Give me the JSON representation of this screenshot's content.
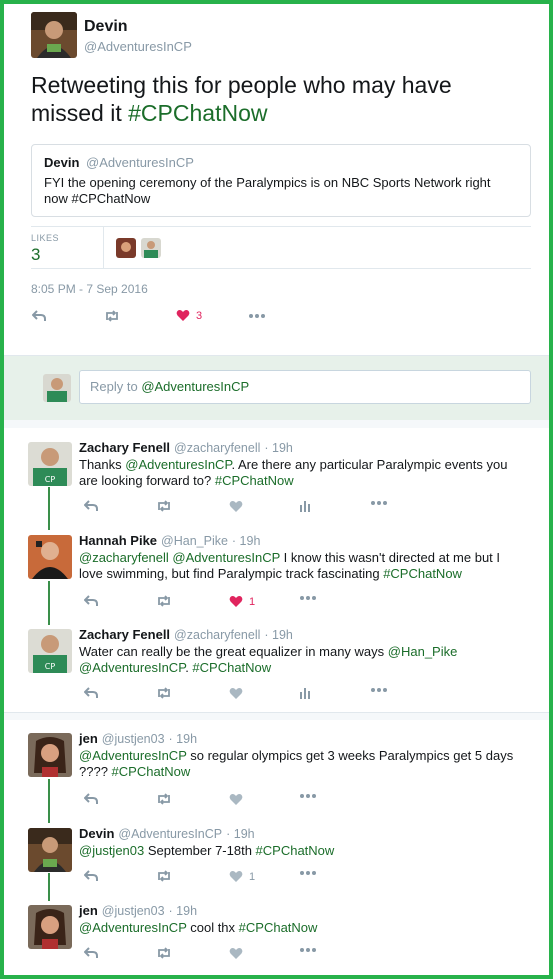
{
  "main": {
    "author_name": "Devin",
    "author_handle": "@AdventuresInCP",
    "text": "Retweeting this for people who may have missed it ",
    "hashtag": "#CPChatNow",
    "quoted": {
      "name": "Devin",
      "handle": "@AdventuresInCP",
      "text": "FYI the opening ceremony of the Paralympics is on NBC Sports Network right now #CPChatNow"
    },
    "likes_label": "LIKES",
    "likes_count": "3",
    "timestamp": "8:05 PM - 7 Sep 2016",
    "heart_count": "3"
  },
  "reply_box": {
    "placeholder_prefix": "Reply to ",
    "placeholder_handle": "@AdventuresInCP"
  },
  "thread1": [
    {
      "name": "Zachary Fenell",
      "handle": "@zacharyfenell",
      "time": "· 19h",
      "text_parts": [
        {
          "t": "Thanks ",
          "link": false
        },
        {
          "t": "@AdventuresInCP",
          "link": true
        },
        {
          "t": ". Are there any particular Paralympic events you are looking forward to? ",
          "link": false
        },
        {
          "t": "#CPChatNow",
          "link": true
        }
      ],
      "like_count": "",
      "liked": false,
      "analytics": true
    },
    {
      "name": "Hannah Pike",
      "handle": "@Han_Pike",
      "time": "· 19h",
      "text_parts": [
        {
          "t": "@zacharyfenell",
          "link": true
        },
        {
          "t": " ",
          "link": false
        },
        {
          "t": "@AdventuresInCP",
          "link": true
        },
        {
          "t": " I know this wasn't directed at me but I love swimming, but find Paralympic track fascinating ",
          "link": false
        },
        {
          "t": "#CPChatNow",
          "link": true
        }
      ],
      "like_count": "1",
      "liked": true,
      "analytics": false
    },
    {
      "name": "Zachary Fenell",
      "handle": "@zacharyfenell",
      "time": "· 19h",
      "text_parts": [
        {
          "t": "Water can really be the great equalizer in many ways ",
          "link": false
        },
        {
          "t": "@Han_Pike",
          "link": true
        },
        {
          "t": " ",
          "link": false
        },
        {
          "t": "@AdventuresInCP",
          "link": true
        },
        {
          "t": ". ",
          "link": false
        },
        {
          "t": "#CPChatNow",
          "link": true
        }
      ],
      "like_count": "",
      "liked": false,
      "analytics": true
    }
  ],
  "thread2": [
    {
      "name": "jen",
      "handle": "@justjen03",
      "time": "· 19h",
      "text_parts": [
        {
          "t": "@AdventuresInCP",
          "link": true
        },
        {
          "t": " so regular olympics get 3 weeks Paralympics get 5 days ???? ",
          "link": false
        },
        {
          "t": "#CPChatNow",
          "link": true
        }
      ],
      "like_count": "",
      "liked": false
    },
    {
      "name": "Devin",
      "handle": "@AdventuresInCP",
      "time": "· 19h",
      "text_parts": [
        {
          "t": "@justjen03",
          "link": true
        },
        {
          "t": " September 7-18th ",
          "link": false
        },
        {
          "t": "#CPChatNow",
          "link": true
        }
      ],
      "like_count": "1",
      "liked": false
    },
    {
      "name": "jen",
      "handle": "@justjen03",
      "time": "· 19h",
      "text_parts": [
        {
          "t": "@AdventuresInCP",
          "link": true
        },
        {
          "t": " cool thx ",
          "link": false
        },
        {
          "t": "#CPChatNow",
          "link": true
        }
      ],
      "like_count": "",
      "liked": false
    }
  ],
  "icons": {
    "reply": "reply-icon",
    "retweet": "retweet-icon",
    "like": "heart-icon",
    "analytics": "analytics-icon",
    "more": "more-icon"
  },
  "colors": {
    "frame": "#28b24b",
    "link": "#1b6d2a",
    "like_active": "#e0245e",
    "muted": "#8899a6",
    "reply_band": "#e7f1ea"
  }
}
